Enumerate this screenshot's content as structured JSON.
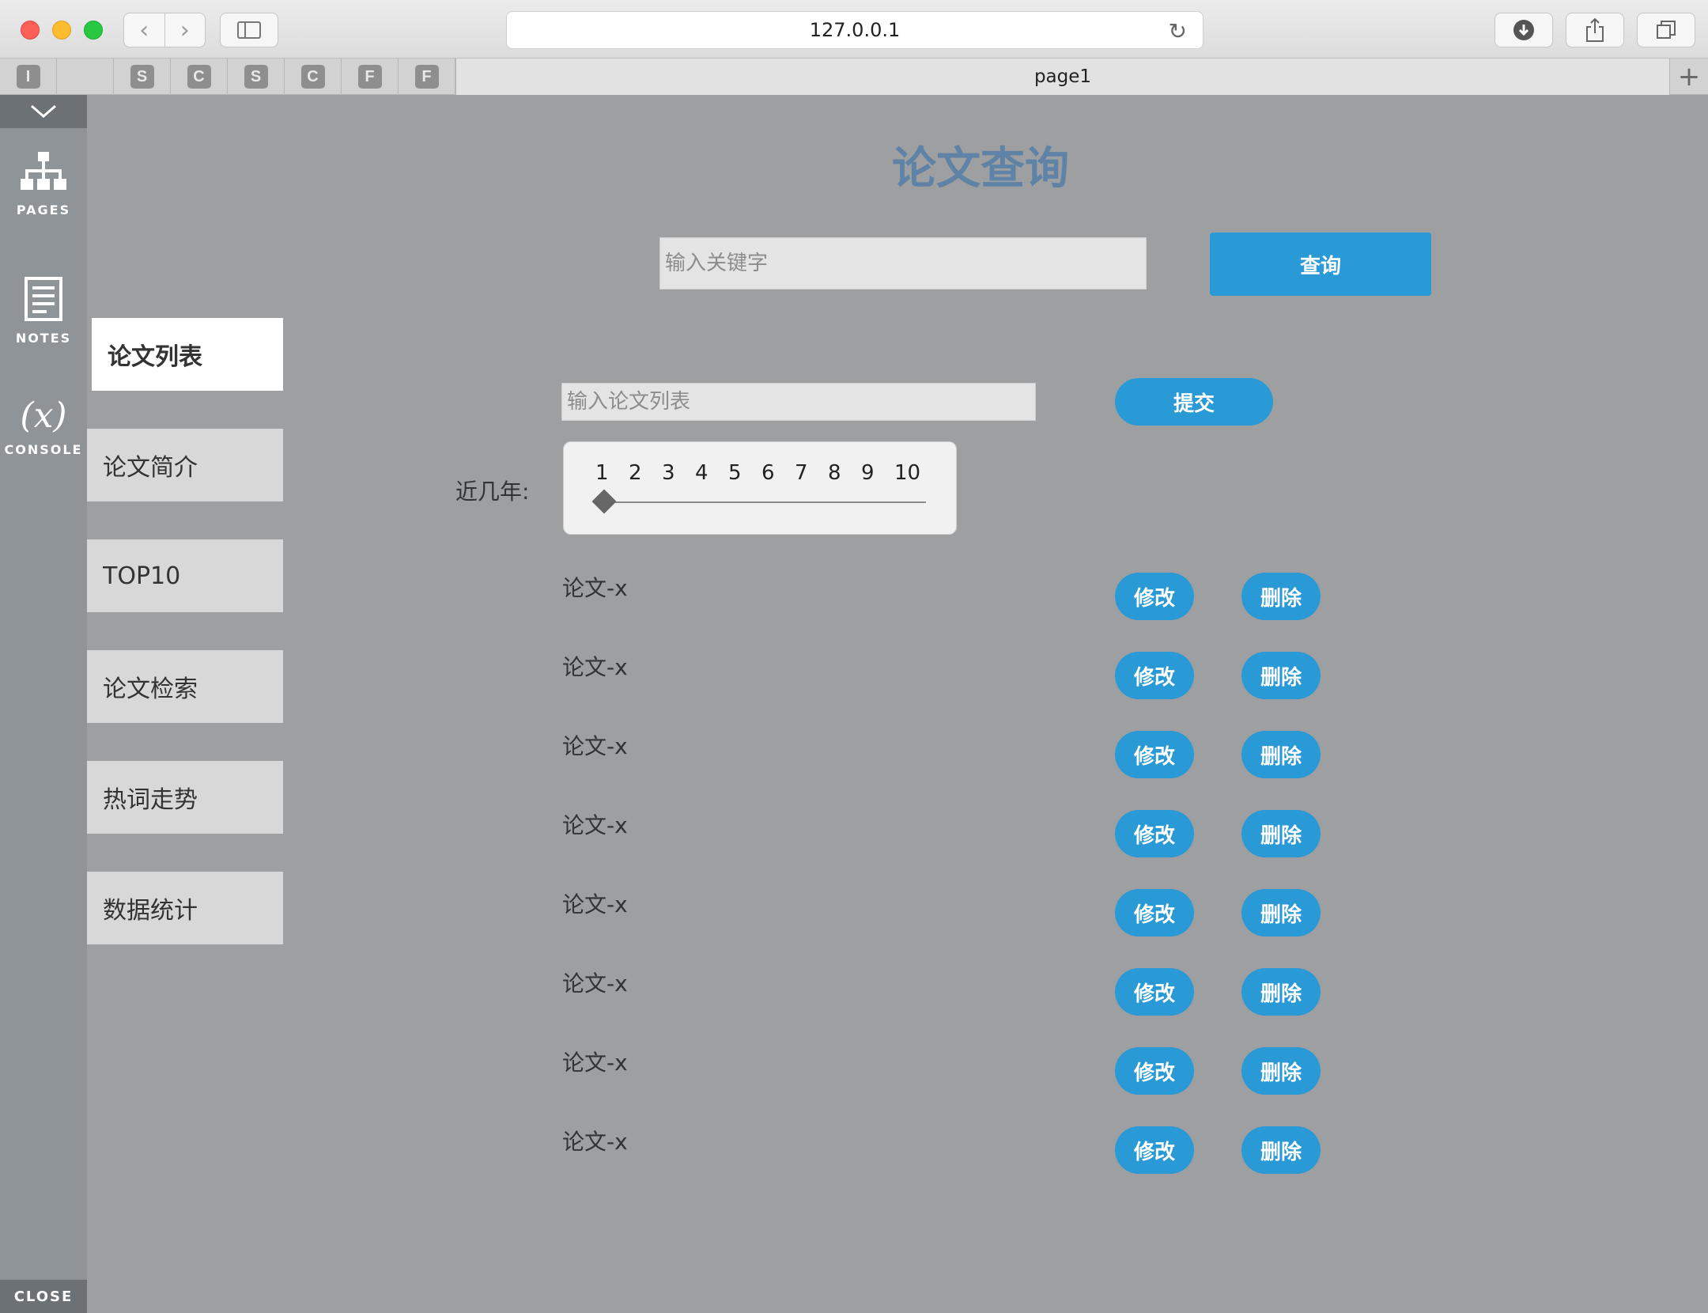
{
  "browser": {
    "url": "127.0.0.1",
    "tab_title": "page1",
    "pinned_tabs": [
      "I",
      "",
      "S",
      "C",
      "S",
      "C",
      "F",
      "F"
    ]
  },
  "rail": {
    "pages_label": "PAGES",
    "notes_label": "NOTES",
    "console_label": "CONSOLE",
    "console_glyph": "(x)",
    "close_label": "CLOSE"
  },
  "page": {
    "title": "论文查询",
    "search": {
      "placeholder": "输入关键字",
      "button": "查询"
    },
    "submit": {
      "placeholder": "输入论文列表",
      "button": "提交"
    },
    "slider": {
      "label": "近几年:",
      "ticks": [
        "1",
        "2",
        "3",
        "4",
        "5",
        "6",
        "7",
        "8",
        "9",
        "10"
      ],
      "value": 1
    },
    "nav": [
      {
        "label": "论文列表",
        "active": true
      },
      {
        "label": "论文简介",
        "active": false
      },
      {
        "label": "TOP10",
        "active": false
      },
      {
        "label": "论文检索",
        "active": false
      },
      {
        "label": "热词走势",
        "active": false
      },
      {
        "label": "数据统计",
        "active": false
      }
    ],
    "rows": [
      {
        "label": "论文-x",
        "edit": "修改",
        "delete": "删除"
      },
      {
        "label": "论文-x",
        "edit": "修改",
        "delete": "删除"
      },
      {
        "label": "论文-x",
        "edit": "修改",
        "delete": "删除"
      },
      {
        "label": "论文-x",
        "edit": "修改",
        "delete": "删除"
      },
      {
        "label": "论文-x",
        "edit": "修改",
        "delete": "删除"
      },
      {
        "label": "论文-x",
        "edit": "修改",
        "delete": "删除"
      },
      {
        "label": "论文-x",
        "edit": "修改",
        "delete": "删除"
      },
      {
        "label": "论文-x",
        "edit": "修改",
        "delete": "删除"
      }
    ]
  },
  "colors": {
    "accent": "#2a9ad6",
    "title": "#5f83a7",
    "background": "#9d9fa1"
  }
}
